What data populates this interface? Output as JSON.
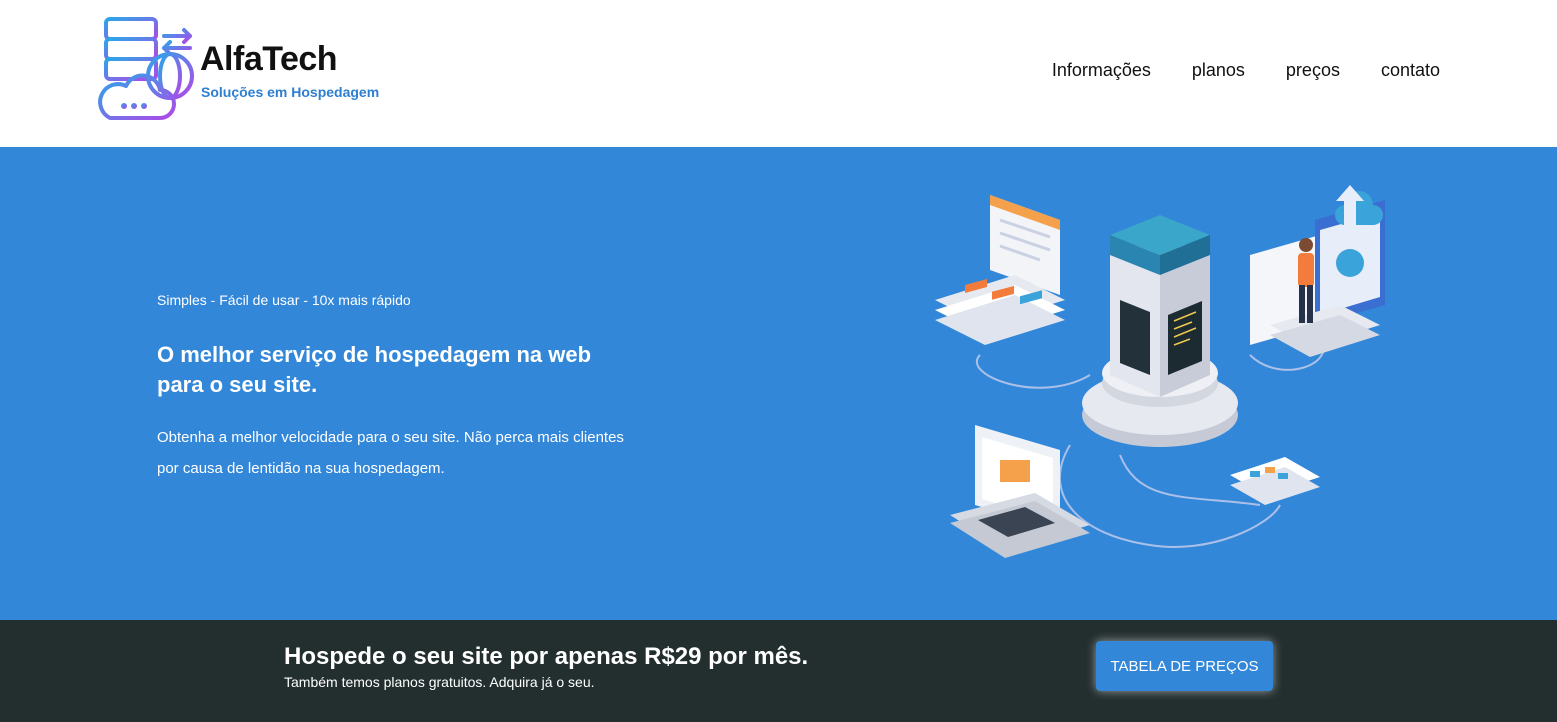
{
  "brand": {
    "name": "AlfaTech",
    "tagline": "Soluções em Hospedagem"
  },
  "nav": {
    "items": [
      "Informações",
      "planos",
      "preços",
      "contato"
    ]
  },
  "hero": {
    "subtitle": "Simples - Fácil de usar - 10x mais rápido",
    "title": "O melhor serviço de hospedagem na web para o seu site.",
    "text": "Obtenha a melhor velocidade para o seu site. Não perca mais clientes por causa de lentidão na sua hospedagem.",
    "illustration": "server-hosting-illustration"
  },
  "banner": {
    "title": "Hospede o seu site por apenas R$29 por mês.",
    "subtitle": "Também temos planos gratuitos. Adquira já o seu.",
    "cta_label": "TABELA DE PREÇOS"
  },
  "colors": {
    "hero_bg": "#3287d9",
    "banner_bg": "#232e2f",
    "accent": "#2e7fd0",
    "logo_gradient_start": "#2aa7e8",
    "logo_gradient_end": "#b048e8"
  }
}
